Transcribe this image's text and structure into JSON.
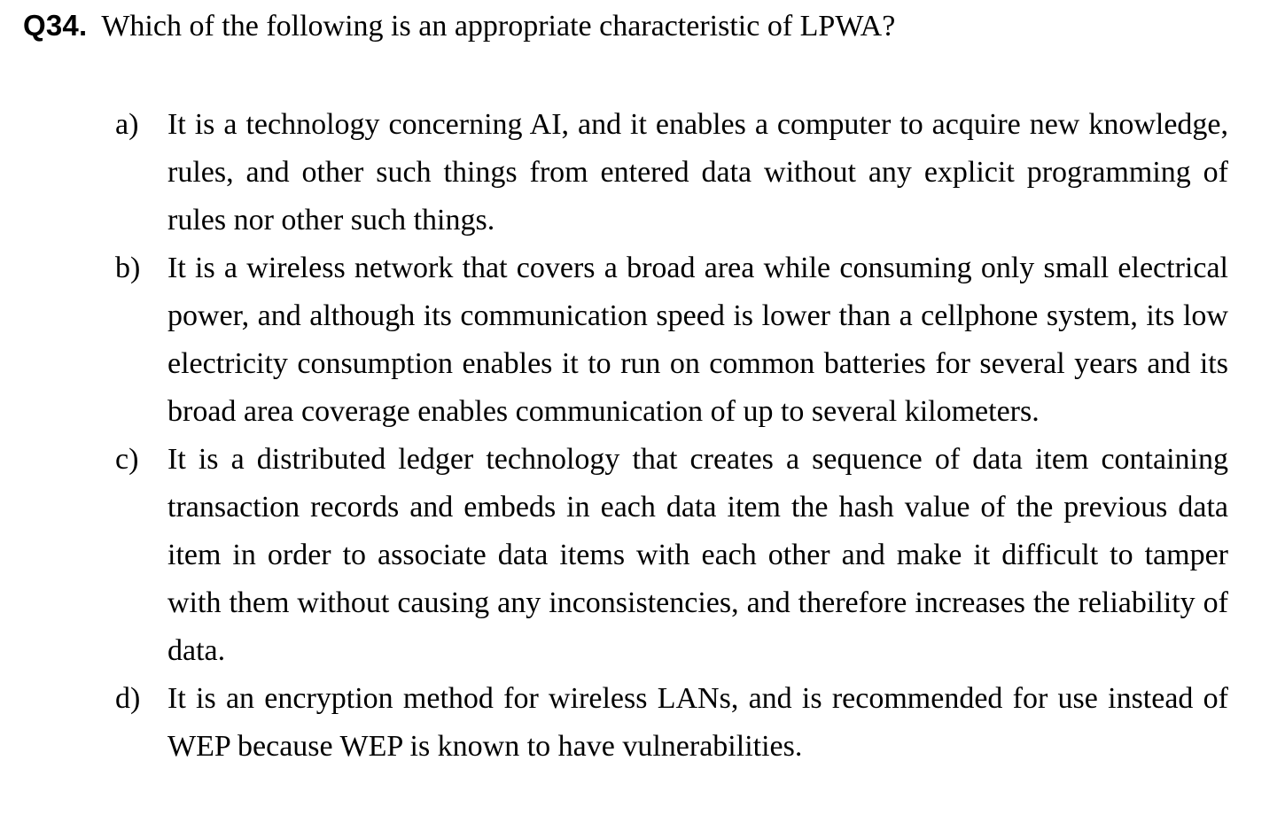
{
  "question": {
    "number": "Q34.",
    "text": "Which of the following is an appropriate characteristic of LPWA?"
  },
  "options": [
    {
      "letter": "a)",
      "text": "It is a technology concerning AI, and it enables a computer to acquire new knowledge, rules, and other such things from entered data without any explicit programming of rules nor other such things."
    },
    {
      "letter": "b)",
      "text": "It is a wireless network that covers a broad area while consuming only small electrical power, and although its communication speed is lower than a cellphone system, its low electricity consumption enables it to run on common batteries for several years and its broad area coverage enables communication of up to several kilometers."
    },
    {
      "letter": "c)",
      "text": "It is a distributed ledger technology that creates a sequence of data item containing transaction records and embeds in each data item the hash value of the previous data item in order to associate data items with each other and make it difficult to tamper with them without causing any inconsistencies, and therefore increases the reliability of data."
    },
    {
      "letter": "d)",
      "text": "It is an encryption method for wireless LANs, and is recommended for use instead of WEP because WEP is known to have vulnerabilities."
    }
  ]
}
